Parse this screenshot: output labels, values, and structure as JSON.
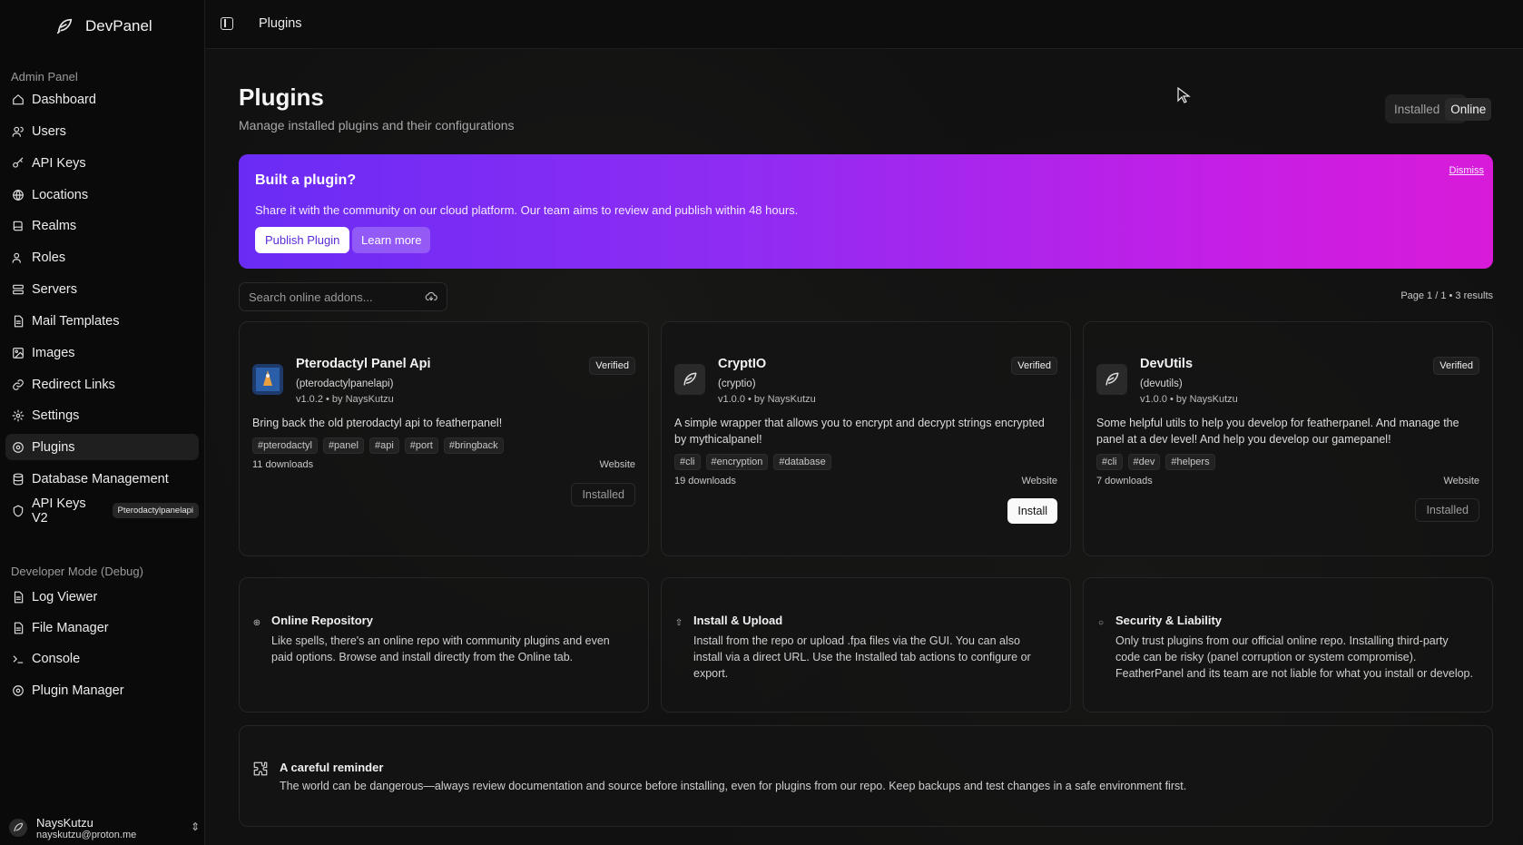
{
  "app": {
    "name": "DevPanel"
  },
  "sidebar": {
    "section_admin": "Admin Panel",
    "items": [
      {
        "label": "Dashboard",
        "icon": "home-icon"
      },
      {
        "label": "Users",
        "icon": "users-icon"
      },
      {
        "label": "API Keys",
        "icon": "key-icon"
      },
      {
        "label": "Locations",
        "icon": "globe-icon"
      },
      {
        "label": "Realms",
        "icon": "book-icon"
      },
      {
        "label": "Roles",
        "icon": "roles-icon"
      },
      {
        "label": "Servers",
        "icon": "server-icon"
      },
      {
        "label": "Mail Templates",
        "icon": "file-icon"
      },
      {
        "label": "Images",
        "icon": "image-icon"
      },
      {
        "label": "Redirect Links",
        "icon": "link-icon"
      },
      {
        "label": "Settings",
        "icon": "gear-icon"
      },
      {
        "label": "Plugins",
        "icon": "plugin-icon"
      },
      {
        "label": "Database Management",
        "icon": "database-icon"
      },
      {
        "label": "API Keys V2",
        "icon": "shield-icon",
        "badge": "Pterodactylpanelapi"
      }
    ],
    "section_dev": "Developer Mode (Debug)",
    "dev_items": [
      {
        "label": "Log Viewer",
        "icon": "file-icon"
      },
      {
        "label": "File Manager",
        "icon": "file-icon"
      },
      {
        "label": "Console",
        "icon": "terminal-icon"
      },
      {
        "label": "Plugin Manager",
        "icon": "plugin-icon"
      }
    ],
    "user": {
      "name": "NaysKutzu",
      "email": "nayskutzu@proton.me"
    }
  },
  "topbar": {
    "title": "Plugins"
  },
  "page": {
    "title": "Plugins",
    "subtitle": "Manage installed plugins and their configurations",
    "tabs": [
      {
        "label": "Installed",
        "active": false
      },
      {
        "label": "Online",
        "active": true
      }
    ]
  },
  "banner": {
    "title": "Built a plugin?",
    "text": "Share it with the community on our cloud platform. Our team aims to review and publish within 48 hours.",
    "primary": "Publish Plugin",
    "secondary": "Learn more",
    "dismiss": "Dismiss",
    "gradient_start": "#6a2cf5",
    "gradient_end": "#d81bd9"
  },
  "search": {
    "placeholder": "Search online addons...",
    "value": ""
  },
  "pagination": {
    "text": "Page 1 / 1 • 3 results"
  },
  "plugins": [
    {
      "name": "Pterodactyl Panel Api",
      "id": "(pterodactylpanelapi)",
      "meta": "v1.0.2 • by NaysKutzu",
      "badge": "Verified",
      "description": "Bring back the old pterodactyl api to featherpanel!",
      "tags": [
        "#pterodactyl",
        "#panel",
        "#api",
        "#port",
        "#bringback"
      ],
      "downloads": "11 downloads",
      "website": "Website",
      "action": "Installed"
    },
    {
      "name": "CryptIO",
      "id": "(cryptio)",
      "meta": "v1.0.0 • by NaysKutzu",
      "badge": "Verified",
      "description": "A simple wrapper that allows you to encrypt and decrypt strings encrypted by mythicalpanel!",
      "tags": [
        "#cli",
        "#encryption",
        "#database"
      ],
      "downloads": "19 downloads",
      "website": "Website",
      "action": "Install"
    },
    {
      "name": "DevUtils",
      "id": "(devutils)",
      "meta": "v1.0.0 • by NaysKutzu",
      "badge": "Verified",
      "description": "Some helpful utils to help you develop for featherpanel. And manage the panel at a dev level! And help you develop our gamepanel!",
      "tags": [
        "#cli",
        "#dev",
        "#helpers"
      ],
      "downloads": "7 downloads",
      "website": "Website",
      "action": "Installed"
    }
  ],
  "info_cards": [
    {
      "title": "Online Repository",
      "text": "Like spells, there's an online repo with community plugins and even paid options. Browse and install directly from the Online tab.",
      "icon": "globe-icon"
    },
    {
      "title": "Install & Upload",
      "text": "Install from the repo or upload .fpa files via the GUI. You can also install via a direct URL. Use the Installed tab actions to configure or export.",
      "icon": "upload-icon"
    },
    {
      "title": "Security & Liability",
      "text": "Only trust plugins from our official online repo. Installing third-party code can be risky (panel corruption or system compromise). FeatherPanel and its team are not liable for what you install or develop.",
      "icon": "shield-icon"
    }
  ],
  "reminder": {
    "title": "A careful reminder",
    "text": "The world can be dangerous—always review documentation and source before installing, even for plugins from our repo. Keep backups and test changes in a safe environment first."
  }
}
